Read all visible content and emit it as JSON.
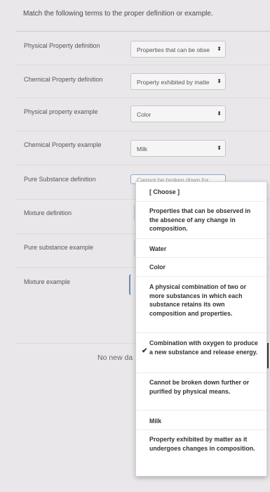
{
  "prompt": "Match the following terms to the proper definition or example.",
  "rows": [
    {
      "label": "Physical Property definition",
      "value": "Properties that can be obse"
    },
    {
      "label": "Chemical Property definition",
      "value": "Property exhibited by matte"
    },
    {
      "label": "Physical property example",
      "value": "Color"
    },
    {
      "label": "Chemical Property example",
      "value": "Milk"
    },
    {
      "label": "Pure Substance definition",
      "value": "Cannot be broken down fur"
    },
    {
      "label": "Mixture definition",
      "value": ""
    },
    {
      "label": "Pure substance example",
      "value": ""
    },
    {
      "label": "Mixture example",
      "value": ""
    }
  ],
  "caret_glyph": "⬍",
  "no_new_text": "No new da",
  "dropdown": {
    "options": [
      "[ Choose ]",
      "Properties that can be observed in the absence of any change in composition.",
      "Water",
      "Color",
      "A physical combination of two or more substances in which each substance retains its own composition and properties.",
      "Combination with oxygen to produce a new substance and release energy.",
      "Cannot be broken down further or purified by physical means.",
      "Milk",
      "Property exhibited by matter as it undergoes changes in composition."
    ],
    "checked_index": 5,
    "check_glyph": "✔"
  }
}
